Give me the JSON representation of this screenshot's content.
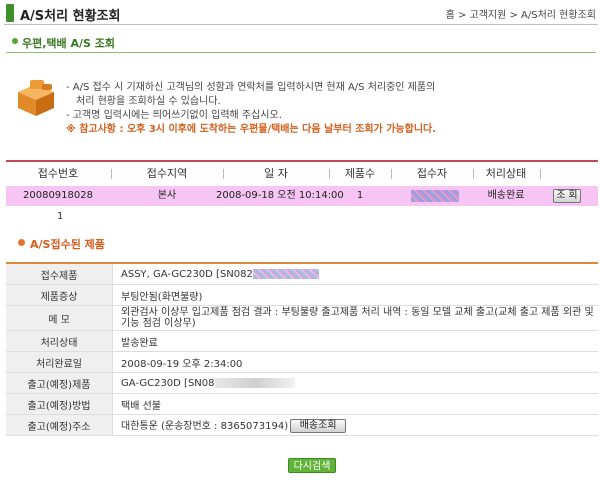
{
  "header": {
    "title": "A/S처리 현황조회",
    "breadcrumb": "홈 > 고객지원 > A/S처리 현황조회"
  },
  "section1": {
    "title": "우편,택배 A/S 조회"
  },
  "info": {
    "line1": "- A/S 접수 시 기재하신 고객님의 성함과 연락처를 입력하시면 현재 A/S 처리중인 제품의",
    "line2": "처리 현황을 조회하실 수 있습니다.",
    "line3": "- 고객명 입력시에는 띄어쓰기없이 입력해 주십시오.",
    "note": "※ 참고사항 : 오후 3시 이후에 도착하는 우편물/택배는 다음 날부터 조회가 가능합니다."
  },
  "list": {
    "headers": [
      "접수번호",
      "접수지역",
      "일 자",
      "제품수",
      "접수자",
      "처리상태"
    ],
    "row": {
      "id": "20080918028",
      "region": "본사",
      "date": "2008-09-18 오전 10:14:00",
      "count": "1",
      "status": "배송완료",
      "button": "조 회"
    },
    "page": "1"
  },
  "section2": {
    "title": "A/S접수된 제품"
  },
  "details": {
    "rows": [
      {
        "label": "접수제품",
        "value": "ASSY, GA-GC230D  [SN082"
      },
      {
        "label": "제품증상",
        "value": "부팅안됨(화면불량)"
      },
      {
        "label": "메    모",
        "value": "외관검사 이상무 입고제품 점검 결과 : 부팅불량 출고제품 처리 내역 : 동일 모델 교체 출고(교체 출고 제품 외관 및 기능 점검 이상무)"
      },
      {
        "label": "처리상태",
        "value": "발송완료"
      },
      {
        "label": "처리완료일",
        "value": "2008-09-19 오후 2:34:00"
      },
      {
        "label": "출고(예정)제품",
        "value": "GA-GC230D  [SN08"
      },
      {
        "label": "출고(예정)방법",
        "value": "택배 선불"
      },
      {
        "label": "출고(예정)주소",
        "value": "대한통운 (운송장번호 : 8365073194)"
      }
    ],
    "track_button": "배송조회"
  },
  "retry_button": "다시검색",
  "colors": {
    "accent_green": "#56a52e",
    "accent_orange": "#e3752b",
    "row_highlight": "#f7c5f4"
  }
}
